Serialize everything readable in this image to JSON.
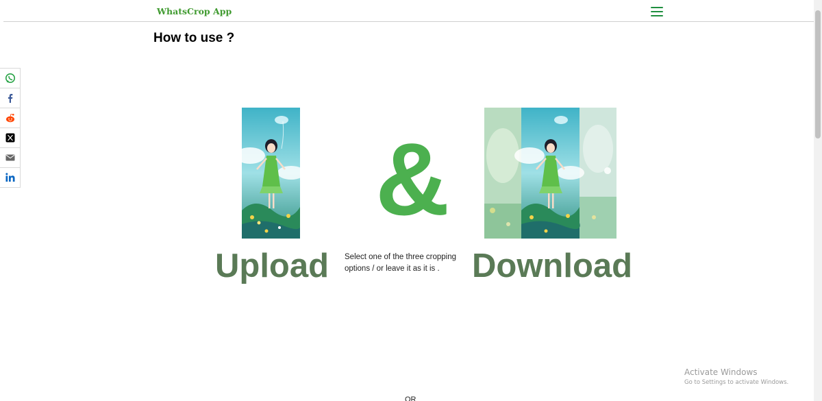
{
  "header": {
    "brand": "WhatsCrop App",
    "menu_icon": "hamburger-menu-icon"
  },
  "main": {
    "title": "How to use ?",
    "ampersand": "&",
    "upload_label": "Upload",
    "download_label": "Download",
    "instruction": "Select one of the three cropping options / or leave it as it is .",
    "or_text": "OR"
  },
  "share_bar": [
    {
      "icon": "whatsapp-icon",
      "color": "#25a244"
    },
    {
      "icon": "facebook-icon",
      "color": "#3b5998"
    },
    {
      "icon": "reddit-icon",
      "color": "#ff4500"
    },
    {
      "icon": "x-twitter-icon",
      "color": "#000000"
    },
    {
      "icon": "email-icon",
      "color": "#666666"
    },
    {
      "icon": "linkedin-icon",
      "color": "#0a66c2"
    }
  ],
  "watermark": {
    "title": "Activate Windows",
    "subtitle": "Go to Settings to activate Windows."
  },
  "colors": {
    "brand": "#3f9a2f",
    "accent": "#4cb04f",
    "label": "#5a7a56"
  }
}
